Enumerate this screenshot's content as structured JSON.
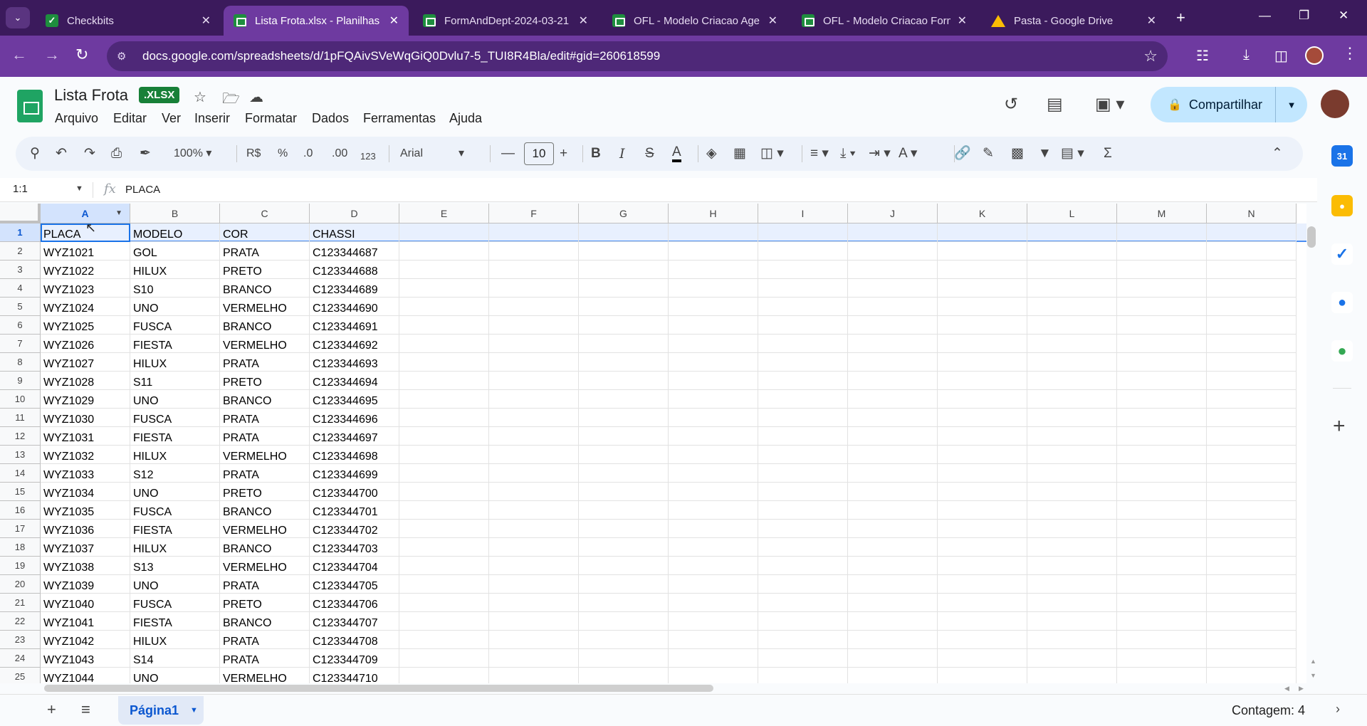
{
  "browser": {
    "tabs": [
      {
        "title": "Checkbits",
        "icon": "checkbits-favicon"
      },
      {
        "title": "Lista Frota.xlsx - Planilhas G",
        "icon": "sheets-favicon",
        "active": true
      },
      {
        "title": "FormAndDept-2024-03-21",
        "icon": "sheets-favicon"
      },
      {
        "title": "OFL - Modelo Criacao Age",
        "icon": "sheets-favicon"
      },
      {
        "title": "OFL - Modelo Criacao Form",
        "icon": "sheets-favicon"
      },
      {
        "title": "Pasta - Google Drive",
        "icon": "drive-favicon"
      }
    ],
    "url": "docs.google.com/spreadsheets/d/1pFQAivSVeWqGiQ0Dvlu7-5_TUI8R4Bla/edit#gid=260618599",
    "accent": "#6e3aa0"
  },
  "doc": {
    "title": "Lista Frota",
    "badge": ".XLSX",
    "menus": [
      "Arquivo",
      "Editar",
      "Ver",
      "Inserir",
      "Formatar",
      "Dados",
      "Ferramentas",
      "Ajuda"
    ],
    "share_label": "Compartilhar"
  },
  "toolbar": {
    "zoom": "100%",
    "currency": "R$",
    "percent": "%",
    "dec_decrease": ".0",
    "dec_increase": ".00",
    "number_format": "123",
    "font": "Arial",
    "font_size": "10"
  },
  "formula_bar": {
    "name_box": "1:1",
    "fx": "fx",
    "value": "PLACA"
  },
  "grid": {
    "columns": [
      "A",
      "B",
      "C",
      "D",
      "E",
      "F",
      "G",
      "H",
      "I",
      "J",
      "K",
      "L",
      "M",
      "N"
    ],
    "rows": [
      [
        "PLACA",
        "MODELO",
        "COR",
        "CHASSI"
      ],
      [
        "WYZ1021",
        "GOL",
        "PRATA",
        "C123344687"
      ],
      [
        "WYZ1022",
        "HILUX",
        "PRETO",
        "C123344688"
      ],
      [
        "WYZ1023",
        "S10",
        "BRANCO",
        "C123344689"
      ],
      [
        "WYZ1024",
        "UNO",
        "VERMELHO",
        "C123344690"
      ],
      [
        "WYZ1025",
        "FUSCA",
        "BRANCO",
        "C123344691"
      ],
      [
        "WYZ1026",
        "FIESTA",
        "VERMELHO",
        "C123344692"
      ],
      [
        "WYZ1027",
        "HILUX",
        "PRATA",
        "C123344693"
      ],
      [
        "WYZ1028",
        "S11",
        "PRETO",
        "C123344694"
      ],
      [
        "WYZ1029",
        "UNO",
        "BRANCO",
        "C123344695"
      ],
      [
        "WYZ1030",
        "FUSCA",
        "PRATA",
        "C123344696"
      ],
      [
        "WYZ1031",
        "FIESTA",
        "PRATA",
        "C123344697"
      ],
      [
        "WYZ1032",
        "HILUX",
        "VERMELHO",
        "C123344698"
      ],
      [
        "WYZ1033",
        "S12",
        "PRATA",
        "C123344699"
      ],
      [
        "WYZ1034",
        "UNO",
        "PRETO",
        "C123344700"
      ],
      [
        "WYZ1035",
        "FUSCA",
        "BRANCO",
        "C123344701"
      ],
      [
        "WYZ1036",
        "FIESTA",
        "VERMELHO",
        "C123344702"
      ],
      [
        "WYZ1037",
        "HILUX",
        "BRANCO",
        "C123344703"
      ],
      [
        "WYZ1038",
        "S13",
        "VERMELHO",
        "C123344704"
      ],
      [
        "WYZ1039",
        "UNO",
        "PRATA",
        "C123344705"
      ],
      [
        "WYZ1040",
        "FUSCA",
        "PRETO",
        "C123344706"
      ],
      [
        "WYZ1041",
        "FIESTA",
        "BRANCO",
        "C123344707"
      ],
      [
        "WYZ1042",
        "HILUX",
        "PRATA",
        "C123344708"
      ],
      [
        "WYZ1043",
        "S14",
        "PRATA",
        "C123344709"
      ],
      [
        "WYZ1044",
        "UNO",
        "VERMELHO",
        "C123344710"
      ]
    ]
  },
  "bottom": {
    "sheet_name": "Página1",
    "status": "Contagem: 4"
  }
}
